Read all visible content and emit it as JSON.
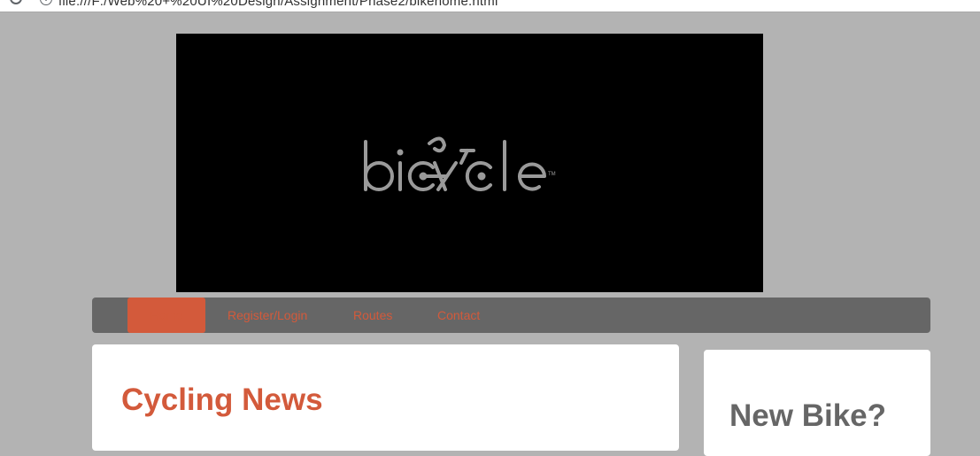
{
  "browser": {
    "url": "file:///F:/Web%20+%20UI%20Design/Assignment/Phase2/bikehome.html"
  },
  "banner": {
    "logo_text": "bicycle",
    "trademark": "TM"
  },
  "nav": {
    "items": [
      {
        "label": "Home",
        "active": true
      },
      {
        "label": "Register/Login",
        "active": false
      },
      {
        "label": "Routes",
        "active": false
      },
      {
        "label": "Contact",
        "active": false
      }
    ]
  },
  "main": {
    "heading": "Cycling News"
  },
  "sidebar": {
    "heading": "New Bike?"
  },
  "colors": {
    "page_bg": "#b3b3b3",
    "accent": "#d35a3b",
    "nav_bg": "#666666",
    "logo_gray": "#9a9a9a"
  },
  "icons": [
    "reload-icon",
    "info-icon"
  ]
}
